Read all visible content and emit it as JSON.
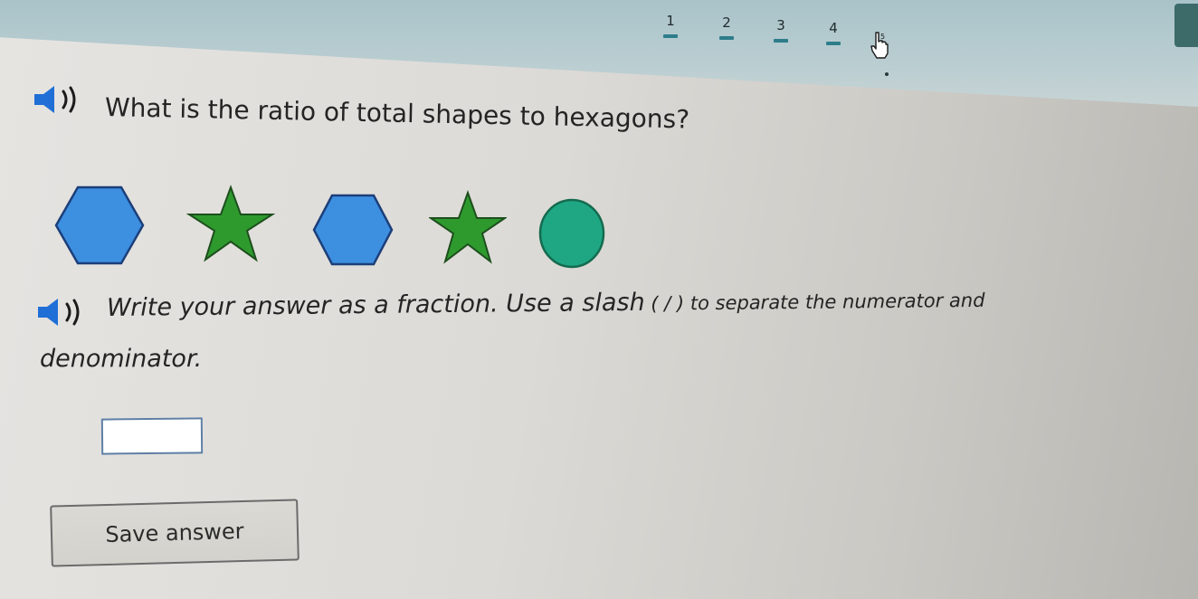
{
  "progress": {
    "steps": [
      "1",
      "2",
      "3",
      "4"
    ],
    "current_step_label": "5"
  },
  "question": {
    "text": "What is the ratio of total shapes to hexagons?"
  },
  "shapes": [
    {
      "kind": "hexagon",
      "color": "#3d8fe0"
    },
    {
      "kind": "star",
      "color": "#2e9a2e"
    },
    {
      "kind": "hexagon",
      "color": "#3d8fe0"
    },
    {
      "kind": "star",
      "color": "#2e9a2e"
    },
    {
      "kind": "circle",
      "color": "#1fa784"
    }
  ],
  "instruction": {
    "line1_large": "Write your answer as a fraction. Use a slash",
    "line1_small": " ( / ) to separate the numerator and",
    "line2": "denominator."
  },
  "answer": {
    "value": "",
    "placeholder": ""
  },
  "save_button": {
    "label": "Save answer"
  },
  "icons": {
    "audio": "speaker-icon",
    "cursor": "hand-cursor-icon"
  }
}
